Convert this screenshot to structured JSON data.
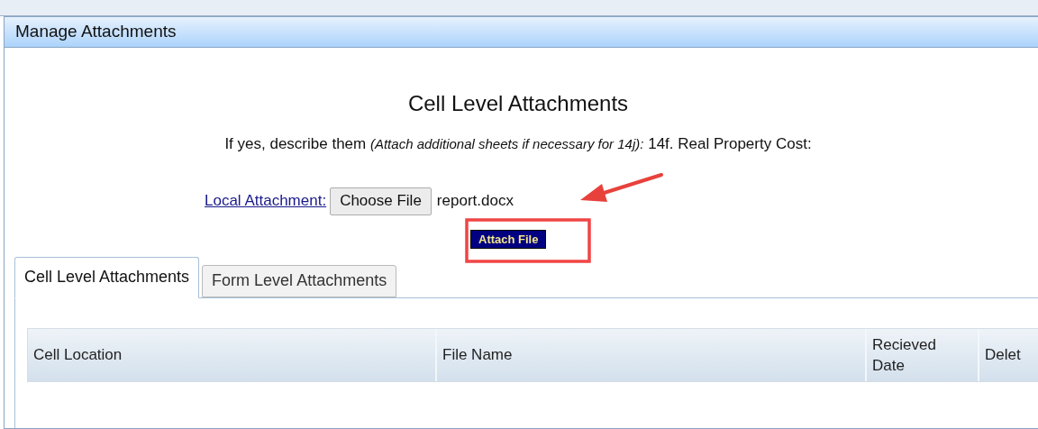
{
  "dialog": {
    "title": "Manage Attachments",
    "heading": "Cell Level Attachments",
    "prompt": {
      "text": "If yes, describe them",
      "note": "(Attach additional sheets if necessary for 14j):",
      "field": "14f. Real Property Cost:"
    },
    "upload": {
      "link": "Local Attachment:",
      "choose_button": "Choose File",
      "file_name": "report.docx",
      "attach_button": "Attach File"
    },
    "tabs": [
      {
        "label": "Cell Level Attachments",
        "selected": true
      },
      {
        "label": "Form Level Attachments",
        "selected": false
      }
    ],
    "table": {
      "columns": [
        "Cell Location",
        "File Name",
        "Recieved Date",
        "Delet"
      ]
    }
  }
}
